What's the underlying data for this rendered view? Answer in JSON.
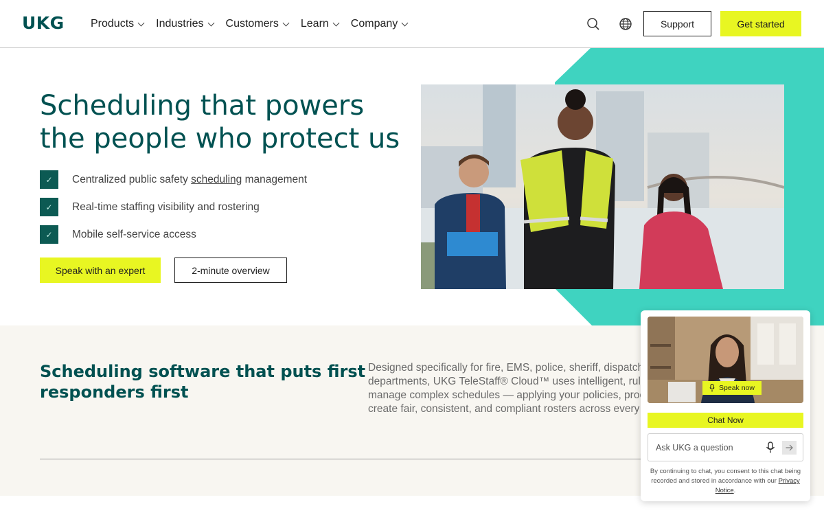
{
  "brand": {
    "logo": "UKG",
    "accent": "#e8f622",
    "primary": "#005151",
    "teal": "#3fd3c0"
  },
  "nav": {
    "items": [
      {
        "label": "Products"
      },
      {
        "label": "Industries"
      },
      {
        "label": "Customers"
      },
      {
        "label": "Learn"
      },
      {
        "label": "Company"
      }
    ],
    "icons": [
      "search-icon",
      "globe-icon"
    ],
    "support_label": "Support",
    "get_started_label": "Get started"
  },
  "hero": {
    "title_line1": "Scheduling that powers",
    "title_line2": "the people who protect us",
    "checks": [
      {
        "before": "Centralized public safety ",
        "link": "scheduling",
        "after": " management"
      },
      {
        "before": "Real-time staffing visibility and rostering",
        "link": "",
        "after": ""
      },
      {
        "before": "Mobile self-service access",
        "link": "",
        "after": ""
      }
    ],
    "primary_cta": "Speak with an expert",
    "secondary_cta": "2-minute overview"
  },
  "section2": {
    "title_line1": "Scheduling software that puts first",
    "title_line2": "responders first",
    "body_lines": [
      "Designed specifically for fire, EMS, police, sheriff, dispatch, and corrections",
      "departments, UKG TeleStaff® Cloud™ uses intelligent, rules-based automation to",
      "manage complex schedules — applying your policies, processes, and contracts to",
      "create fair, consistent, and compliant rosters across every shift."
    ]
  },
  "chat": {
    "speak_now": "Speak now",
    "chat_now": "Chat Now",
    "input_placeholder": "Ask UKG a question",
    "consent_text": "By continuing to chat, you consent to this chat being recorded and stored in accordance with our",
    "consent_link": "Privacy Notice",
    "consent_end": "."
  }
}
